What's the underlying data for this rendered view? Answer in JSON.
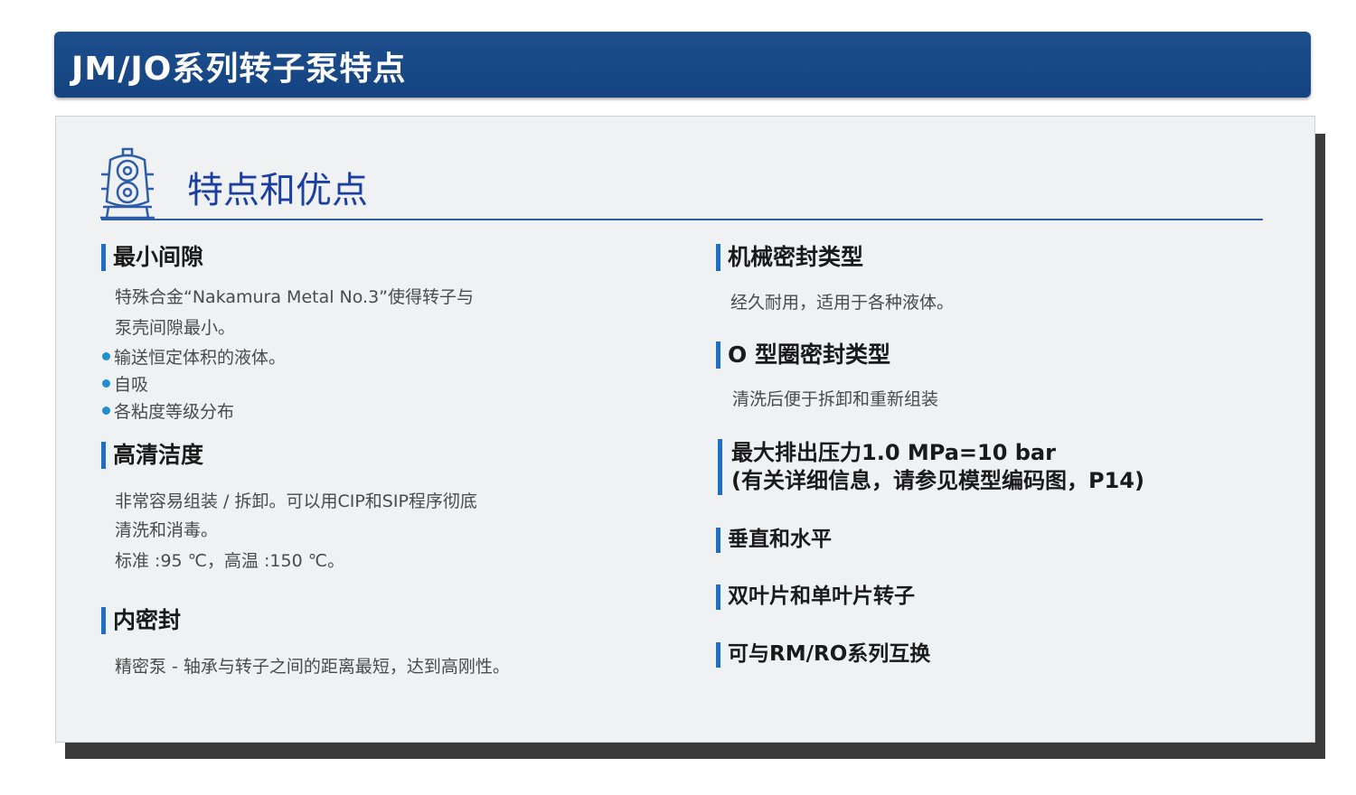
{
  "header": {
    "title": "JM/JO系列转子泵特点"
  },
  "hero": {
    "title": "特点和优点",
    "icon": "rotor-pump-icon"
  },
  "left": {
    "min_gap": {
      "heading": "最小间隙",
      "lines": [
        "特殊合金“Nakamura Metal No.3”使得转子与",
        "泵壳间隙最小。"
      ],
      "bullets": [
        "输送恒定体积的液体。",
        "自吸",
        "各粘度等级分布"
      ]
    },
    "hygiene": {
      "heading": "高清洁度",
      "lines": [
        "非常容易组装 / 拆卸。可以用CIP和SIP程序彻底",
        "清洗和消毒。",
        "标准 :95 ℃，高温  :150 ℃。"
      ]
    },
    "inner_seal": {
      "heading": "内密封",
      "line": "精密泵 - 轴承与转子之间的距离最短，达到高刚性。"
    }
  },
  "right": {
    "mech_seal": {
      "heading": "机械密封类型",
      "line": "经久耐用，适用于各种液体。"
    },
    "oring_seal": {
      "heading": "O 型圈密封类型",
      "line": "清洗后便于拆卸和重新组装"
    },
    "pressure": {
      "line1": "最大排出压力1.0 MPa=10 bar",
      "line2": "(有关详细信息，请参见模型编码图，P14)"
    },
    "orientation": {
      "heading": "垂直和水平"
    },
    "rotor_types": {
      "heading": "双叶片和单叶片转子"
    },
    "interchange": {
      "heading": "可与RM/RO系列互换"
    }
  },
  "colors": {
    "title_bar": "#1d4f8c",
    "accent": "#1e6fc4",
    "hero_text": "#1a3fa0",
    "bullet": "#1e8fd0"
  }
}
